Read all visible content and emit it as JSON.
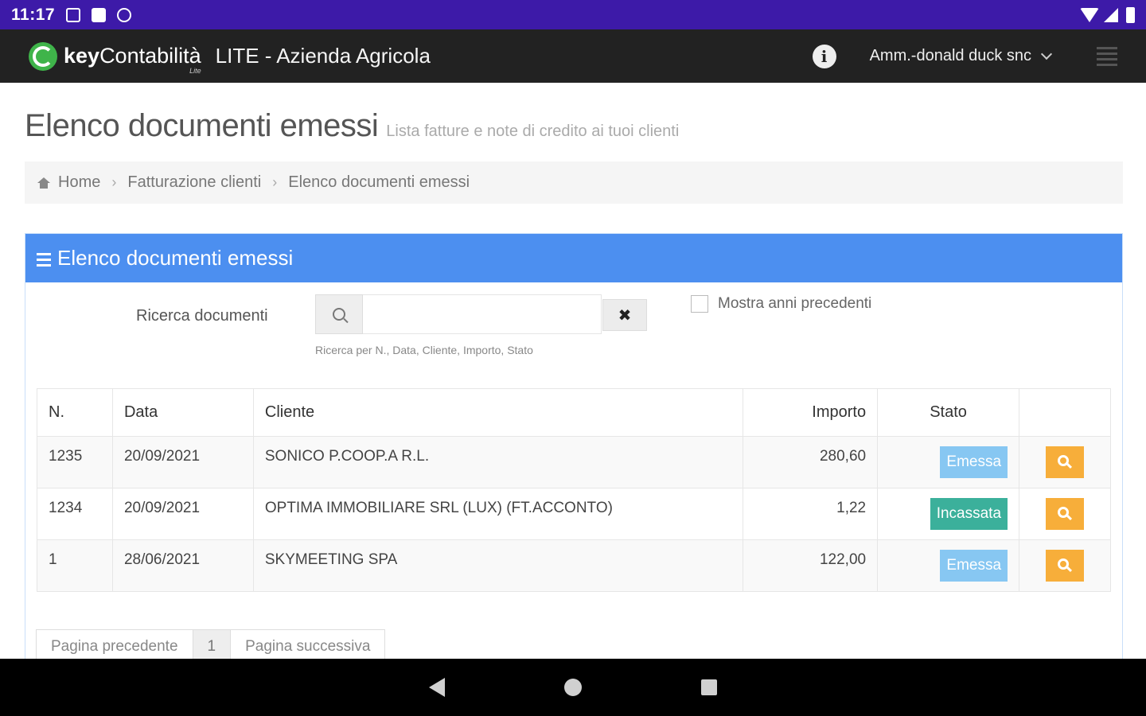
{
  "status_bar": {
    "time": "11:17"
  },
  "app_header": {
    "brand_bold": "key",
    "brand_regular": "Contabilità",
    "brand_sub": "Lite",
    "app_title": "LITE - Azienda Agricola",
    "user_menu_label": "Amm.-donald duck snc"
  },
  "page": {
    "title": "Elenco documenti emessi",
    "subtitle": "Lista fatture e note di credito ai tuoi clienti"
  },
  "breadcrumb": {
    "items": [
      "Home",
      "Fatturazione clienti",
      "Elenco documenti emessi"
    ]
  },
  "panel": {
    "title": "Elenco documenti emessi",
    "search_label": "Ricerca documenti",
    "search_value": "",
    "search_placeholder": "",
    "clear_label": "✖",
    "search_help": "Ricerca per N., Data, Cliente, Importo, Stato",
    "checkbox_label": "Mostra anni precedenti",
    "checkbox_checked": false
  },
  "table": {
    "headers": [
      "N.",
      "Data",
      "Cliente",
      "Importo",
      "Stato",
      ""
    ],
    "rows": [
      {
        "n": "1235",
        "data": "20/09/2021",
        "cliente": "SONICO P.COOP.A R.L.",
        "importo": "280,60",
        "stato": "Emessa"
      },
      {
        "n": "1234",
        "data": "20/09/2021",
        "cliente": "OPTIMA IMMOBILIARE SRL (LUX) (FT.ACCONTO)",
        "importo": "1,22",
        "stato": "Incassata"
      },
      {
        "n": "1",
        "data": "28/06/2021",
        "cliente": "SKYMEETING SPA",
        "importo": "122,00",
        "stato": "Emessa"
      }
    ]
  },
  "pagination": {
    "prev_label": "Pagina precedente",
    "current_page": "1",
    "next_label": "Pagina successiva"
  },
  "colors": {
    "status_bar": "#3d1aa8",
    "app_header": "#222222",
    "panel_header": "#4c8ff0",
    "badge_emessa": "#87c7f2",
    "badge_incassata": "#3bb09b",
    "view_button": "#f7ae3a"
  },
  "icons": [
    "photo-icon",
    "sd-card-icon",
    "sync-icon",
    "wifi-icon",
    "signal-icon",
    "battery-icon",
    "logo-icon",
    "info-icon",
    "chevron-down-icon",
    "hamburger-icon",
    "home-icon",
    "menu-icon",
    "search-icon",
    "close-icon",
    "zoom-icon",
    "back-icon",
    "home-nav-icon",
    "recents-icon"
  ]
}
